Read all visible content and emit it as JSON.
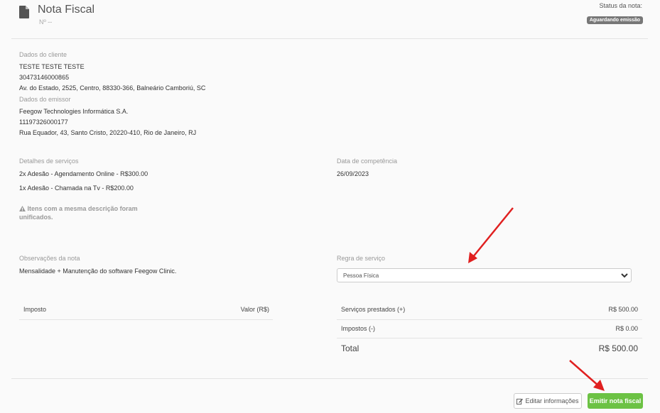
{
  "header": {
    "title": "Nota Fiscal",
    "number": "Nº --",
    "status_label": "Status da nota:",
    "status_badge": "Aguardando emissão"
  },
  "cliente": {
    "label": "Dados do cliente",
    "name": "TESTE TESTE TESTE",
    "doc": "30473146000865",
    "address": "Av. do Estado, 2525, Centro, 88330-366, Balneário Camboriú, SC"
  },
  "emissor": {
    "label": "Dados do emissor",
    "name": "Feegow Technologies Informática S.A.",
    "doc": "11197326000177",
    "address": "Rua Equador, 43, Santo Cristo, 20220-410, Rio de Janeiro, RJ"
  },
  "servicos": {
    "label": "Detalhes de serviços",
    "items": [
      "2x Adesão - Agendamento Online - R$300.00",
      "1x Adesão - Chamada na Tv - R$200.00"
    ],
    "warning": "Itens com a mesma descrição foram unificados."
  },
  "competencia": {
    "label": "Data de competência",
    "value": "26/09/2023"
  },
  "observacoes": {
    "label": "Observações da nota",
    "value": "Mensalidade + Manutenção do software Feegow Clinic."
  },
  "regra": {
    "label": "Regra de serviço",
    "selected": "Pessoa Física"
  },
  "impostos_table": {
    "col1": "Imposto",
    "col2": "Valor (R$)"
  },
  "resumo": {
    "servicos_label": "Serviços prestados (+)",
    "servicos_value": "R$ 500.00",
    "impostos_label": "Impostos (-)",
    "impostos_value": "R$ 0.00",
    "total_label": "Total",
    "total_value": "R$ 500.00"
  },
  "buttons": {
    "edit": "Editar informações",
    "emit": "Emitir nota fiscal"
  },
  "colors": {
    "emit_button": "#6cc244",
    "badge": "#777777",
    "annotation_arrow": "#e02020"
  }
}
